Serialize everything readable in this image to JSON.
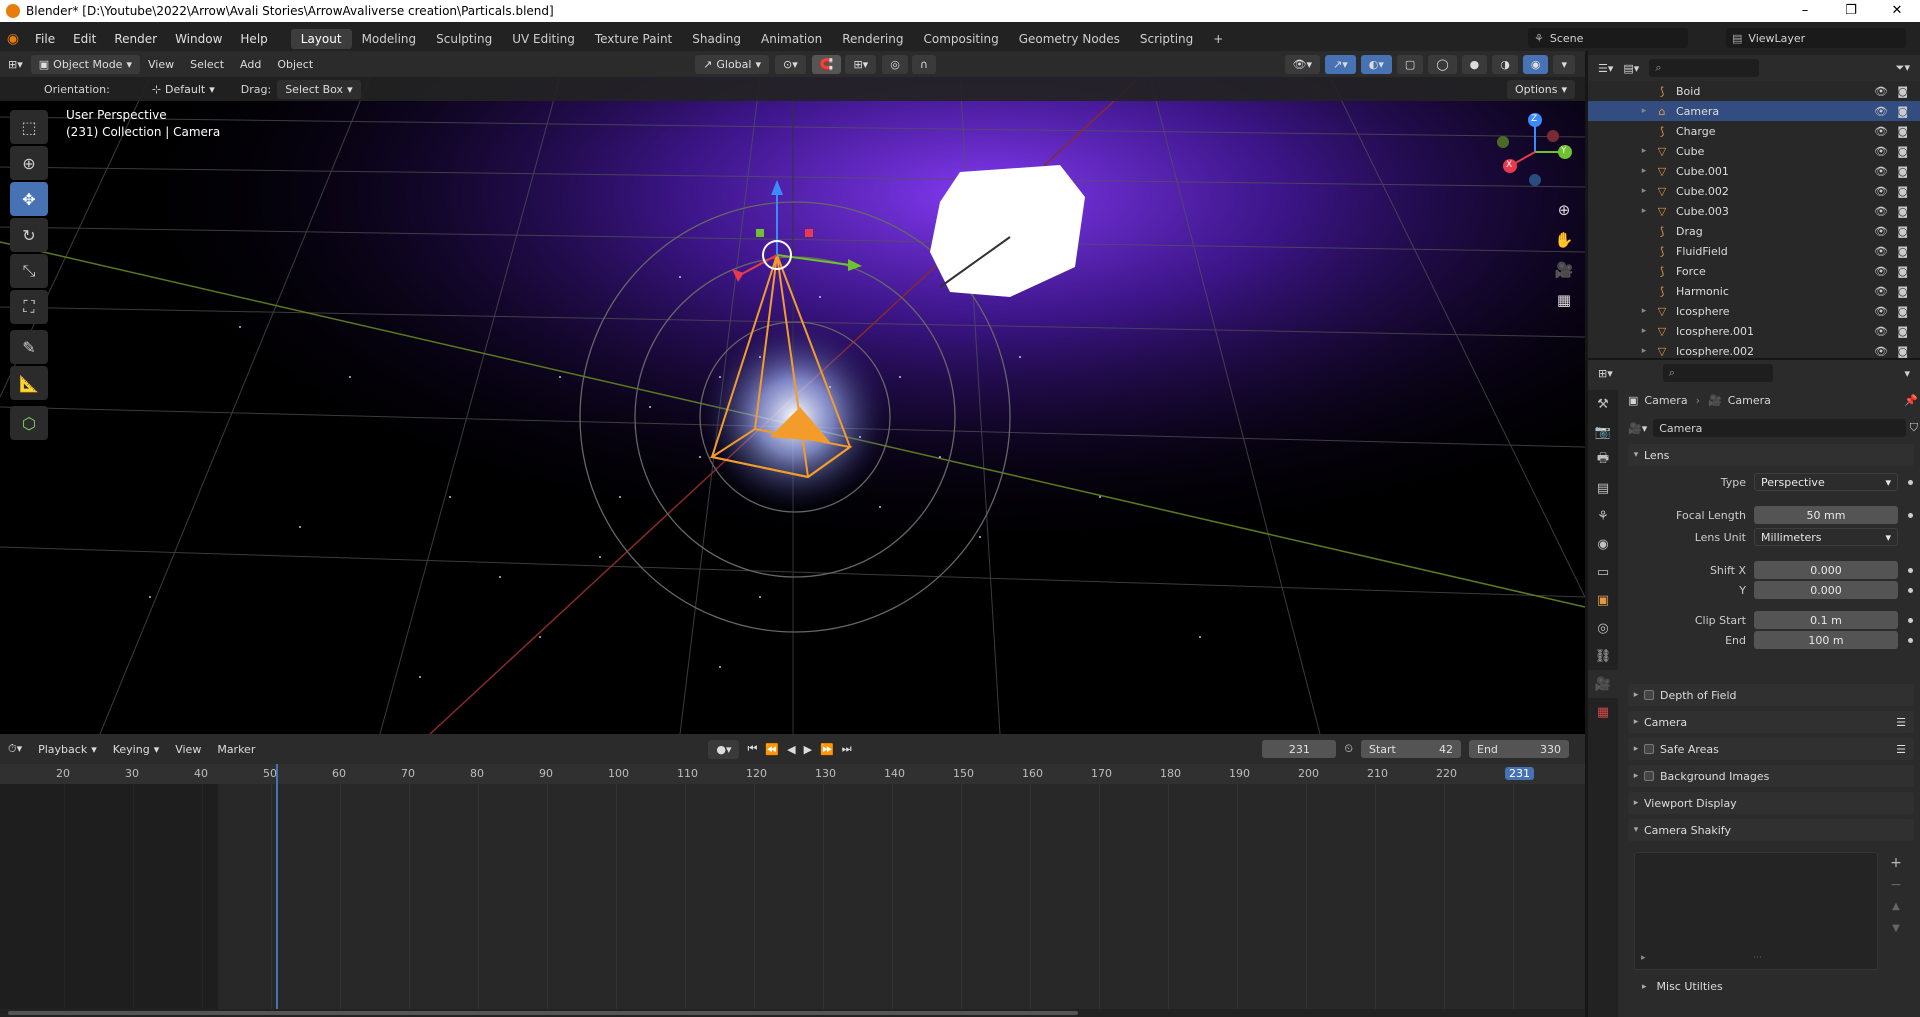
{
  "window": {
    "title": "Blender* [D:\\Youtube\\2022\\Arrow\\Avali Stories\\ArrowAvaliverse creation\\Particals.blend]",
    "minimize": "–",
    "maximize": "❐",
    "close": "✕"
  },
  "menu": [
    "File",
    "Edit",
    "Render",
    "Window",
    "Help"
  ],
  "workspaces": [
    "Layout",
    "Modeling",
    "Sculpting",
    "UV Editing",
    "Texture Paint",
    "Shading",
    "Animation",
    "Rendering",
    "Compositing",
    "Geometry Nodes",
    "Scripting"
  ],
  "workspace_add": "+",
  "scene": {
    "name": "Scene",
    "view_layer": "ViewLayer"
  },
  "viewport_header": {
    "mode": "Object Mode",
    "menus": [
      "View",
      "Select",
      "Add",
      "Object"
    ],
    "transform": "Global"
  },
  "tool_options": {
    "orientation_label": "Orientation:",
    "orientation_value": "Default",
    "drag_label": "Drag:",
    "drag_value": "Select Box",
    "options": "Options"
  },
  "viewport": {
    "perspective": "User Perspective",
    "collection": "(231) Collection | Camera",
    "gizmo_axes": [
      "X",
      "Y",
      "Z"
    ]
  },
  "outliner": {
    "items": [
      {
        "name": "Boid",
        "expandable": false,
        "icon": "force-field-icon",
        "selected": false
      },
      {
        "name": "Camera",
        "expandable": true,
        "icon": "camera-object-icon",
        "selected": true
      },
      {
        "name": "Charge",
        "expandable": false,
        "icon": "force-field-icon",
        "selected": false
      },
      {
        "name": "Cube",
        "expandable": true,
        "icon": "mesh-object-icon",
        "selected": false
      },
      {
        "name": "Cube.001",
        "expandable": true,
        "icon": "mesh-object-icon",
        "selected": false
      },
      {
        "name": "Cube.002",
        "expandable": true,
        "icon": "mesh-object-icon",
        "selected": false
      },
      {
        "name": "Cube.003",
        "expandable": true,
        "icon": "mesh-object-icon",
        "selected": false
      },
      {
        "name": "Drag",
        "expandable": false,
        "icon": "force-field-icon",
        "selected": false
      },
      {
        "name": "FluidField",
        "expandable": false,
        "icon": "force-field-icon",
        "selected": false
      },
      {
        "name": "Force",
        "expandable": false,
        "icon": "force-field-icon",
        "selected": false
      },
      {
        "name": "Harmonic",
        "expandable": false,
        "icon": "force-field-icon",
        "selected": false
      },
      {
        "name": "Icosphere",
        "expandable": true,
        "icon": "mesh-object-icon",
        "selected": false
      },
      {
        "name": "Icosphere.001",
        "expandable": true,
        "icon": "mesh-object-icon",
        "selected": false
      },
      {
        "name": "Icosphere.002",
        "expandable": true,
        "icon": "mesh-object-icon",
        "selected": false
      }
    ]
  },
  "properties": {
    "breadcrumb": [
      "Camera",
      "Camera"
    ],
    "datablock": "Camera",
    "lens_panel": "Lens",
    "type": {
      "label": "Type",
      "value": "Perspective"
    },
    "focal_length": {
      "label": "Focal Length",
      "value": "50 mm"
    },
    "lens_unit": {
      "label": "Lens Unit",
      "value": "Millimeters"
    },
    "shift_x": {
      "label": "Shift X",
      "value": "0.000"
    },
    "shift_y": {
      "label": "Y",
      "value": "0.000"
    },
    "clip_start": {
      "label": "Clip Start",
      "value": "0.1 m"
    },
    "clip_end": {
      "label": "End",
      "value": "100 m"
    },
    "panels": [
      "Depth of Field",
      "Camera",
      "Safe Areas",
      "Background Images",
      "Viewport Display",
      "Camera Shakify"
    ],
    "misc": "Misc Utilties"
  },
  "timeline": {
    "menus": [
      "Playback",
      "Keying",
      "View",
      "Marker"
    ],
    "current_frame": "231",
    "start_label": "Start",
    "start": "42",
    "end_label": "End",
    "end": "330",
    "ruler": [
      "20",
      "30",
      "40",
      "50",
      "60",
      "70",
      "80",
      "90",
      "100",
      "110",
      "120",
      "130",
      "140",
      "150",
      "160",
      "170",
      "180",
      "190",
      "200",
      "210",
      "220",
      "231"
    ]
  },
  "colors": {
    "accent": "#4772b3",
    "selection": "#334d80",
    "camera_orange": "#f39c2b",
    "playhead": "#4772b3",
    "blender_orange": "#e87d0d"
  }
}
